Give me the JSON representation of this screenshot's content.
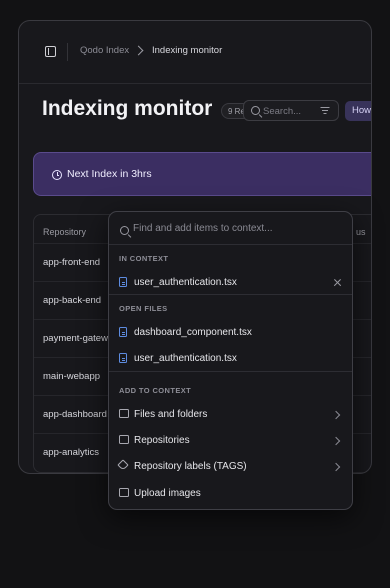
{
  "breadcrumb": {
    "parent": "Qodo Index",
    "current": "Indexing monitor"
  },
  "page": {
    "title": "Indexing monitor",
    "badge": "9 Re"
  },
  "search": {
    "placeholder": "Search..."
  },
  "how_button": "How",
  "banner": {
    "text": "Next Index in 3hrs"
  },
  "table": {
    "headers": [
      "Repository",
      "us"
    ],
    "rows": [
      "app-front-end",
      "app-back-end",
      "payment-gatewa",
      "main-webapp",
      "app-dashboard",
      "app-analytics"
    ]
  },
  "popup": {
    "input_placeholder": "Find and add items to context...",
    "in_context": {
      "title": "IN CONTEXT",
      "items": [
        "user_authentication.tsx"
      ]
    },
    "open_files": {
      "title": "OPEN FILES",
      "items": [
        "dashboard_component.tsx",
        "user_authentication.tsx"
      ]
    },
    "add_to_context": {
      "title": "ADD TO CONTEXT",
      "items": [
        "Files and folders",
        "Repositories",
        "Repository labels (TAGS)",
        "Upload images"
      ]
    }
  },
  "colors": {
    "accent": "#3b2e62",
    "file_icon": "#5e8ce0"
  }
}
